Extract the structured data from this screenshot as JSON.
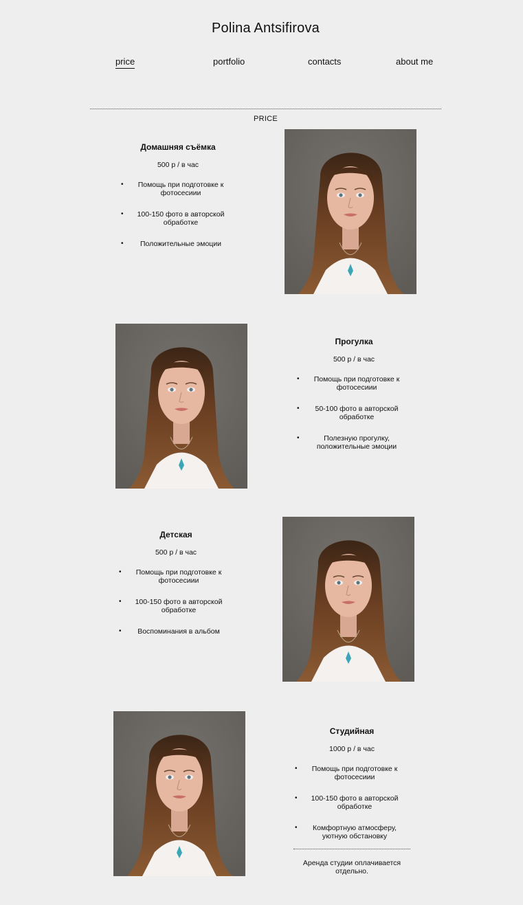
{
  "header": {
    "title": "Polina Antsifirova"
  },
  "nav": {
    "items": [
      {
        "label": "price",
        "active": true
      },
      {
        "label": "portfolio",
        "active": false
      },
      {
        "label": "contacts",
        "active": false
      },
      {
        "label": "about me",
        "active": false
      }
    ]
  },
  "section": {
    "label": "PRICE"
  },
  "packages": [
    {
      "title": "Домашняя съёмка",
      "price": "500 р / в час",
      "features": [
        "Помощь при подготовке к фотосесиии",
        "100-150 фото в авторской обработке",
        "Положительные эмоции"
      ]
    },
    {
      "title": "Прогулка",
      "price": "500 р / в час",
      "features": [
        "Помощь при подготовке к фотосесиии",
        "50-100 фото в авторской обработке",
        "Полезную прогулку, положительные эмоции"
      ]
    },
    {
      "title": "Детская",
      "price": "500 р / в час",
      "features": [
        "Помощь при подготовке к фотосесиии",
        "100-150 фото в авторской обработке",
        "Воспоминания в альбом"
      ]
    },
    {
      "title": "Студийная",
      "price": "1000 р / в час",
      "features": [
        "Помощь при подготовке к фотосесиии",
        "100-150 фото в авторской обработке",
        "Комфортную атмосферу, уютную обстановку"
      ],
      "note": "Аренда студии оплачивается отдельно."
    }
  ],
  "colors": {
    "background": "#eeeeee",
    "text": "#111111",
    "photo_backdrop": "#5f5c58",
    "hair": "#6b3f22",
    "skin": "#e6b8a2",
    "shirt": "#f4f1ee",
    "pendant": "#3aa7b8"
  },
  "icons": {
    "portrait": "portrait-photo"
  }
}
